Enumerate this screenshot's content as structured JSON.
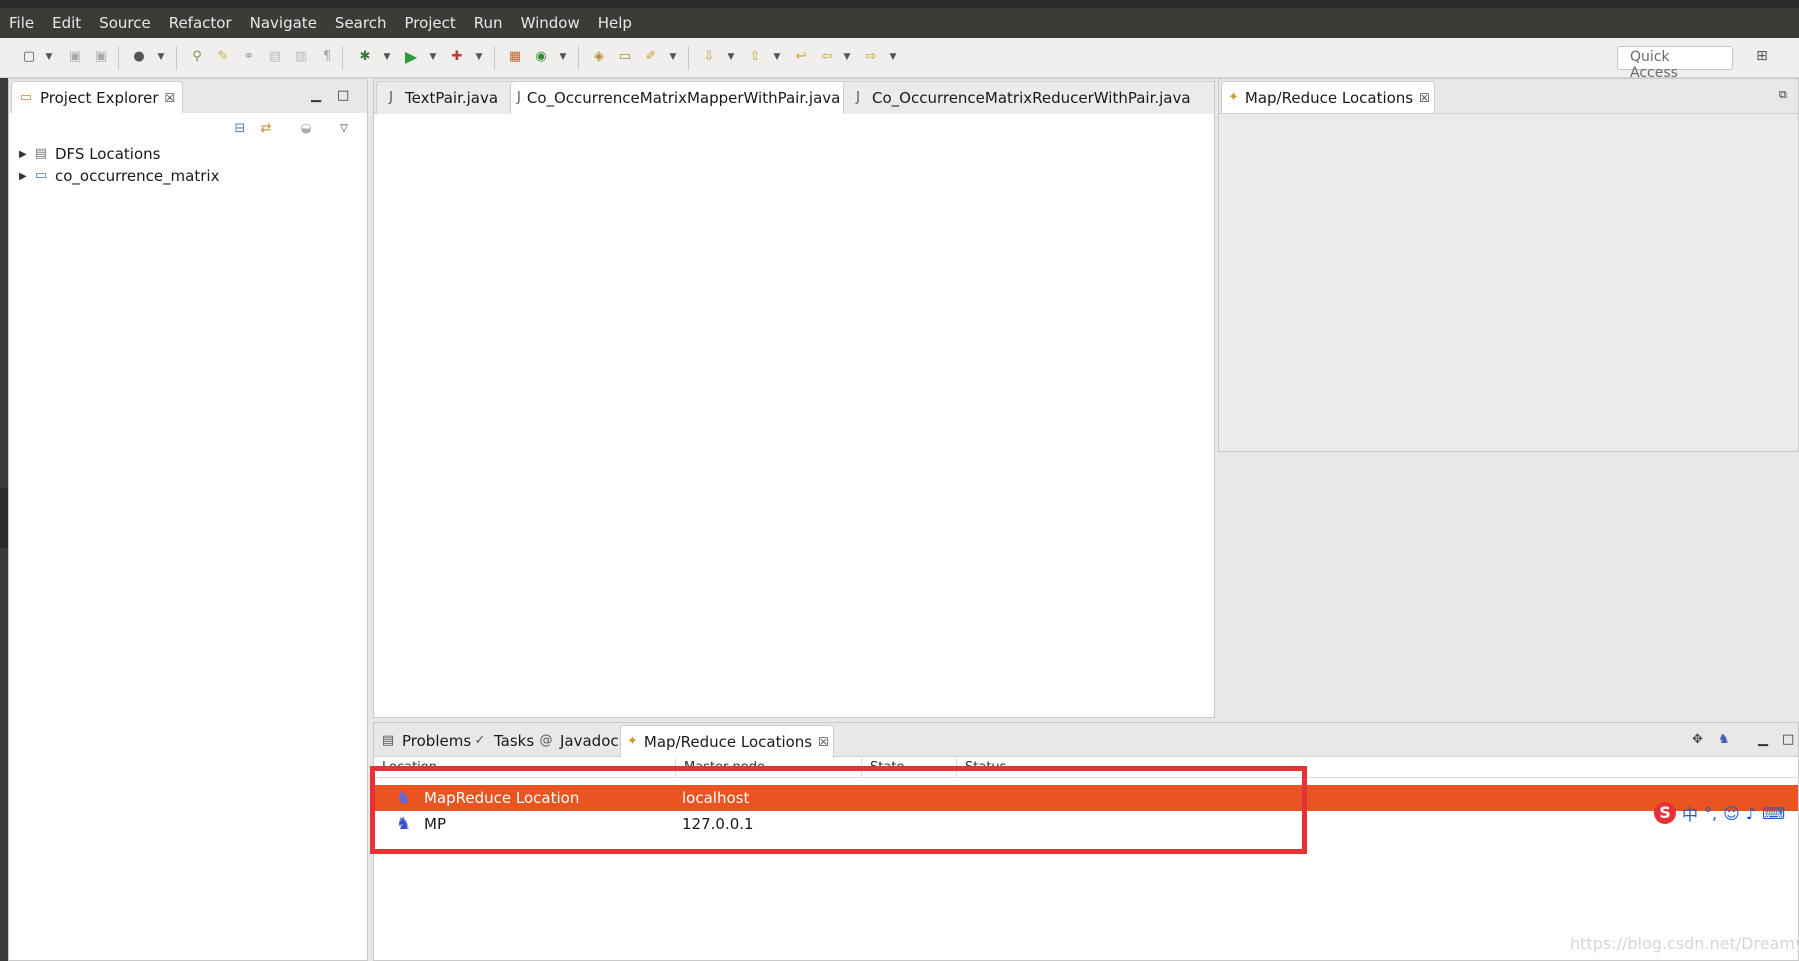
{
  "menu": [
    "File",
    "Edit",
    "Source",
    "Refactor",
    "Navigate",
    "Search",
    "Project",
    "Run",
    "Window",
    "Help"
  ],
  "toolbar": {
    "quick_access": "Quick Access"
  },
  "explorer": {
    "title": "Project Explorer",
    "items": [
      "DFS Locations",
      "co_occurrence_matrix"
    ]
  },
  "editor": {
    "tabs": [
      "TextPair.java",
      "Co_OccurrenceMatrixMapperWithPair.java",
      "Co_OccurrenceMatrixReducerWithPair.java"
    ],
    "active_tab": 1
  },
  "mr_view": {
    "title": "Map/Reduce Locations"
  },
  "bottom": {
    "tabs": [
      "Problems",
      "Tasks",
      "Javadoc",
      "Map/Reduce Locations"
    ],
    "columns": [
      "Location",
      "Master node",
      "State",
      "Status"
    ],
    "rows": [
      {
        "location": "MapReduce Location",
        "master": "localhost",
        "selected": true
      },
      {
        "location": "MP",
        "master": "127.0.0.1",
        "selected": false
      }
    ]
  },
  "ime": {
    "glyphs": [
      "中",
      "°,"
    ]
  },
  "watermark": "https://blog.csdn.net/Dreamy_Z",
  "colors": {
    "accent": "#e95420",
    "highlight_box": "#e53238"
  }
}
